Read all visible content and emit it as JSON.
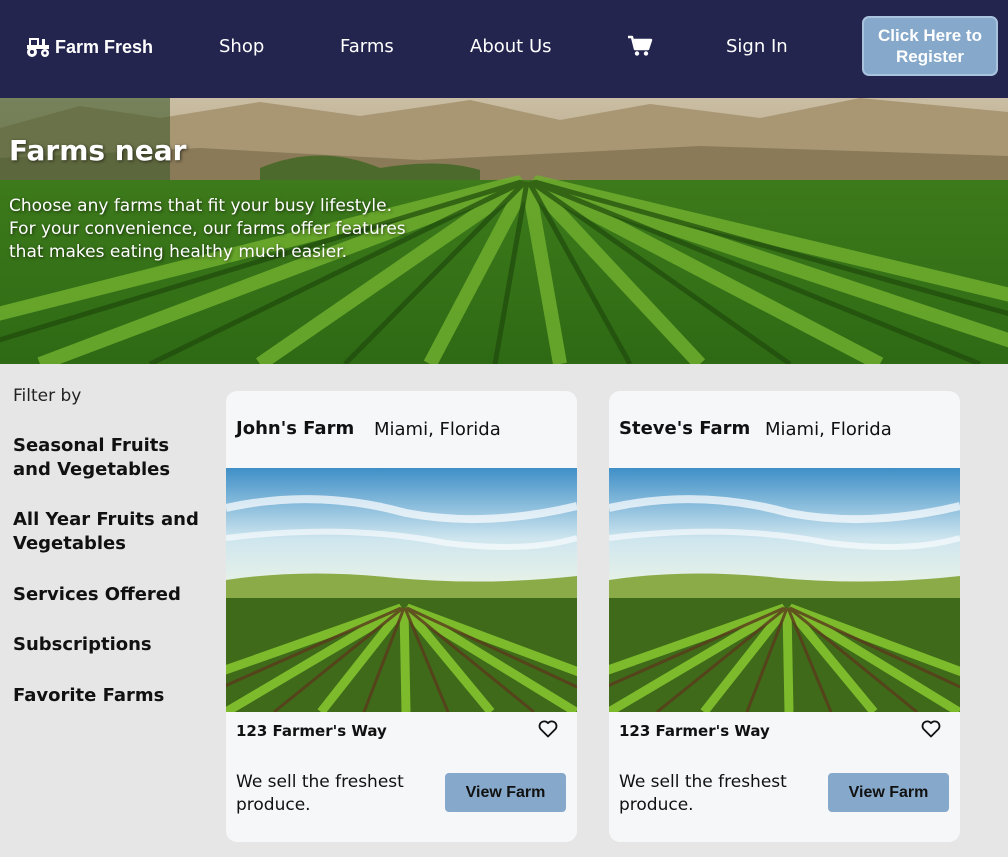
{
  "nav": {
    "brand": "Farm Fresh",
    "links": [
      "Shop",
      "Farms",
      "About Us",
      "Sign In"
    ],
    "register": "Click Here to Register",
    "icons": {
      "brand": "tractor-icon",
      "cart": "cart-icon"
    }
  },
  "hero": {
    "title": "Farms near",
    "description": "Choose any farms that fit your busy lifestyle. For your convenience, our farms offer features that makes eating healthy much easier."
  },
  "filter": {
    "title": "Filter by",
    "items": [
      "Seasonal Fruits and Vegetables",
      "All Year Fruits and Vegetables",
      "Services Offered",
      "Subscriptions",
      "Favorite Farms"
    ]
  },
  "farms": [
    {
      "name": "John's Farm",
      "location": "Miami, Florida",
      "address": "123 Farmer's Way",
      "description": "We sell the freshest produce.",
      "button": "View Farm"
    },
    {
      "name": "Steve's Farm",
      "location": "Miami, Florida",
      "address": "123 Farmer's Way",
      "description": "We sell the freshest produce.",
      "button": "View Farm"
    }
  ],
  "colors": {
    "nav_bg": "#23254f",
    "button_bg": "#86a9cb",
    "page_bg": "#e6e6e6",
    "card_bg": "#f6f7f9"
  }
}
